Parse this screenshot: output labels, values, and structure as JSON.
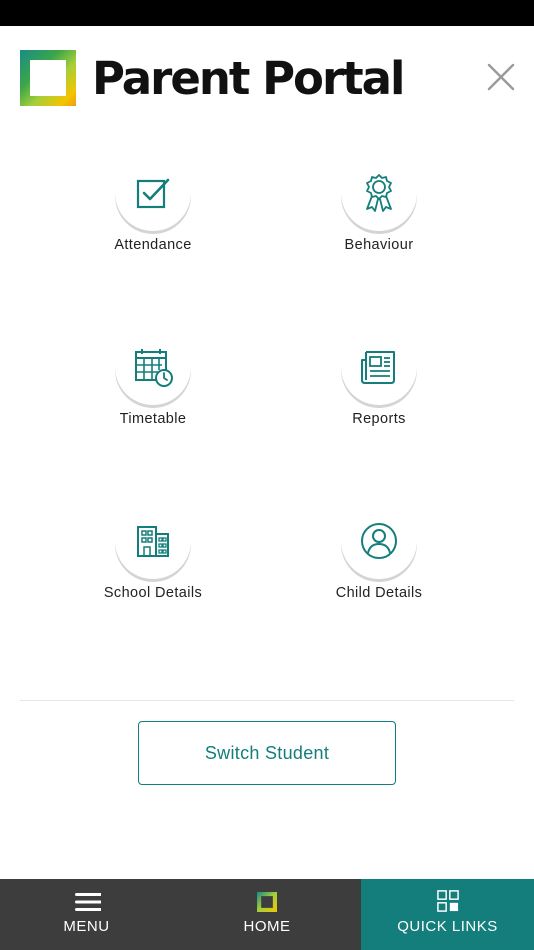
{
  "header": {
    "app_title": "Parent Portal",
    "close_icon": "close-icon",
    "logo_colors": [
      "#1a8b86",
      "#5cb85c",
      "#a6ce39",
      "#f2c500",
      "#f39c12"
    ]
  },
  "tiles": [
    {
      "label": "Attendance",
      "icon": "checkbox-icon"
    },
    {
      "label": "Behaviour",
      "icon": "award-ribbon-icon"
    },
    {
      "label": "Timetable",
      "icon": "calendar-clock-icon"
    },
    {
      "label": "Reports",
      "icon": "newspaper-icon"
    },
    {
      "label": "School Details",
      "icon": "building-icon"
    },
    {
      "label": "Child Details",
      "icon": "user-circle-icon"
    }
  ],
  "switch_student": {
    "label": "Switch Student"
  },
  "bottom_nav": [
    {
      "label": "MENU",
      "icon": "hamburger-menu-icon",
      "active": false
    },
    {
      "label": "HOME",
      "icon": "home-logo-icon",
      "active": false
    },
    {
      "label": "QUICK LINKS",
      "icon": "grid-icon",
      "active": true
    }
  ],
  "colors": {
    "accent": "#137e7b",
    "nav_background": "#3d3d3d",
    "nav_active": "#137e7b"
  }
}
